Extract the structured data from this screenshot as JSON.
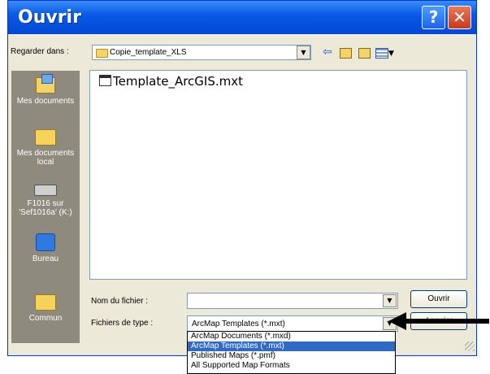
{
  "window": {
    "title": "Ouvrir"
  },
  "titlebar": {
    "help_label": "?",
    "close_label": "✕"
  },
  "toolbar": {
    "look_in_label": "Regarder dans :",
    "look_in_value": "Copie_template_XLS",
    "icons": [
      "back-icon",
      "up-folder-icon",
      "new-folder-icon",
      "views-menu-icon"
    ]
  },
  "sidebar": {
    "items": [
      {
        "label": "Mes documents",
        "icon": "my-documents-icon"
      },
      {
        "label": "Mes documents local",
        "icon": "folder-icon"
      },
      {
        "label": "F1016 sur 'Sef1016a' (K:)",
        "icon": "network-drive-icon"
      },
      {
        "label": "Bureau",
        "icon": "desktop-icon"
      },
      {
        "label": "Commun",
        "icon": "folder-icon"
      }
    ]
  },
  "file_list": {
    "items": [
      {
        "name": "Template_ArcGIS.mxt",
        "icon": "template-file-icon"
      }
    ]
  },
  "form": {
    "file_name_label": "Nom du fichier :",
    "file_name_value": "",
    "file_type_label": "Fichiers de type :",
    "file_type_value": "ArcMap Templates (*.mxt)",
    "open_label": "Ouvrir",
    "cancel_label": "Annuler",
    "file_type_options": [
      "ArcMap Documents (*.mxd)",
      "ArcMap Templates (*.mxt)",
      "Published Maps (*.pmf)",
      "All Supported Map Formats"
    ],
    "selected_option_index": 1
  },
  "colors": {
    "titlebar": "#0a5be6",
    "dialog_bg": "#ece9d8",
    "places_bar": "#8e8a7e",
    "selection": "#316ac5"
  }
}
